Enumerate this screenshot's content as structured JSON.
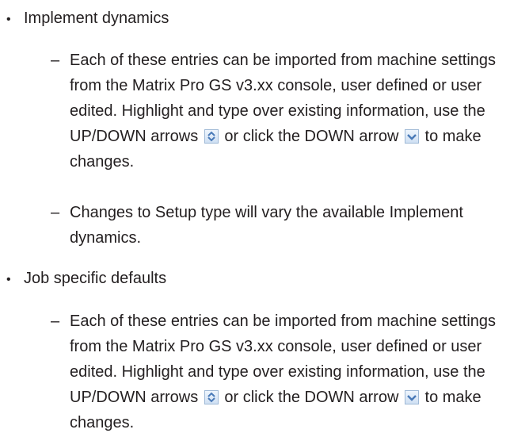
{
  "bullets": [
    {
      "label": "Implement dynamics",
      "subitems": [
        {
          "dash": "–",
          "text_before_updown": "Each of these entries can be imported from machine settings from the Matrix Pro GS v3.xx console, user defined or user edited. Highlight and type over existing information, use the UP/DOWN arrows",
          "text_middle": "or click the DOWN arrow",
          "text_after": "to make changes."
        },
        {
          "dash": "–",
          "text": "Changes to Setup type will vary the available Implement dynamics."
        }
      ]
    },
    {
      "label": "Job specific defaults",
      "subitems": [
        {
          "dash": "–",
          "text_before_updown": "Each of these entries can be imported from machine settings from the Matrix Pro GS v3.xx console, user defined or user edited. Highlight and type over existing information, use the UP/DOWN arrows",
          "text_middle": "or click the DOWN arrow",
          "text_after": "to make changes."
        }
      ]
    }
  ],
  "bullet_glyph": "•",
  "icons": {
    "updown": "up-down-arrows-icon",
    "down": "down-arrow-icon",
    "accent": "#4a7ab8"
  }
}
